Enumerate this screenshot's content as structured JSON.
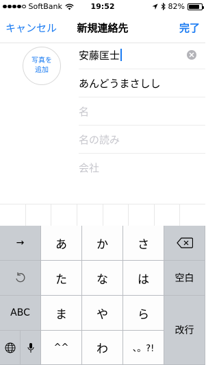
{
  "status_bar": {
    "carrier": "SoftBank",
    "time": "19:52",
    "battery": "82%",
    "battery_level": 0.82,
    "signal_bars_filled": 4,
    "signal_bars_total": 5
  },
  "nav": {
    "cancel": "キャンセル",
    "title": "新規連絡先",
    "done": "完了"
  },
  "photo": {
    "line1": "写真を",
    "line2": "追加"
  },
  "fields": {
    "name_value": "安藤匡士",
    "reading_value": "あんどうまさしし",
    "first_name_placeholder": "名",
    "first_reading_placeholder": "名の読み",
    "company_placeholder": "会社"
  },
  "keyboard": {
    "row1": [
      "→",
      "あ",
      "か",
      "さ",
      "⌫"
    ],
    "row2": [
      "↺",
      "た",
      "な",
      "は",
      "空白"
    ],
    "row3": [
      "ABC",
      "ま",
      "や",
      "ら",
      "改行"
    ],
    "row4": [
      "🌐",
      "🎤",
      "^^",
      "わ",
      "、。?!"
    ]
  },
  "colors": {
    "accent": "#1a7bf2"
  }
}
